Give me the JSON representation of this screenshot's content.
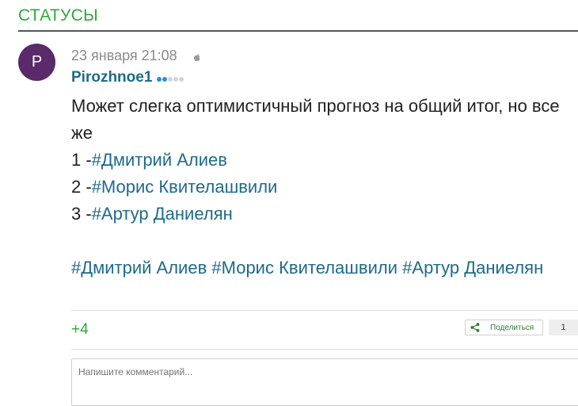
{
  "section": {
    "title": "СТАТУСЫ"
  },
  "post": {
    "avatar_letter": "P",
    "date": "23 января 21:08",
    "author": "Pirozhnoe1",
    "rank": {
      "filled": 2,
      "total": 5
    },
    "text_line1": "Может слегка оптимистичный прогноз на общий итог, но все же",
    "list": [
      {
        "prefix": "1 -",
        "tag": "#Дмитрий Алиев"
      },
      {
        "prefix": "2 -",
        "tag": "#Морис Квителашвили"
      },
      {
        "prefix": "3 -",
        "tag": "#Артур Даниелян"
      }
    ],
    "hashtags": [
      "#Дмитрий Алиев",
      "#Морис Квителашвили",
      "#Артур Даниелян"
    ],
    "plus": "+4",
    "share_label": "Поделиться",
    "share_count": "1"
  },
  "comment": {
    "placeholder": "Напишите комментарий..."
  },
  "colors": {
    "accent_green": "#2eaa3c",
    "link_blue": "#1f6a8a",
    "avatar": "#5a2a6b"
  },
  "icons": {
    "platform": "apple-icon",
    "share": "share-icon"
  }
}
